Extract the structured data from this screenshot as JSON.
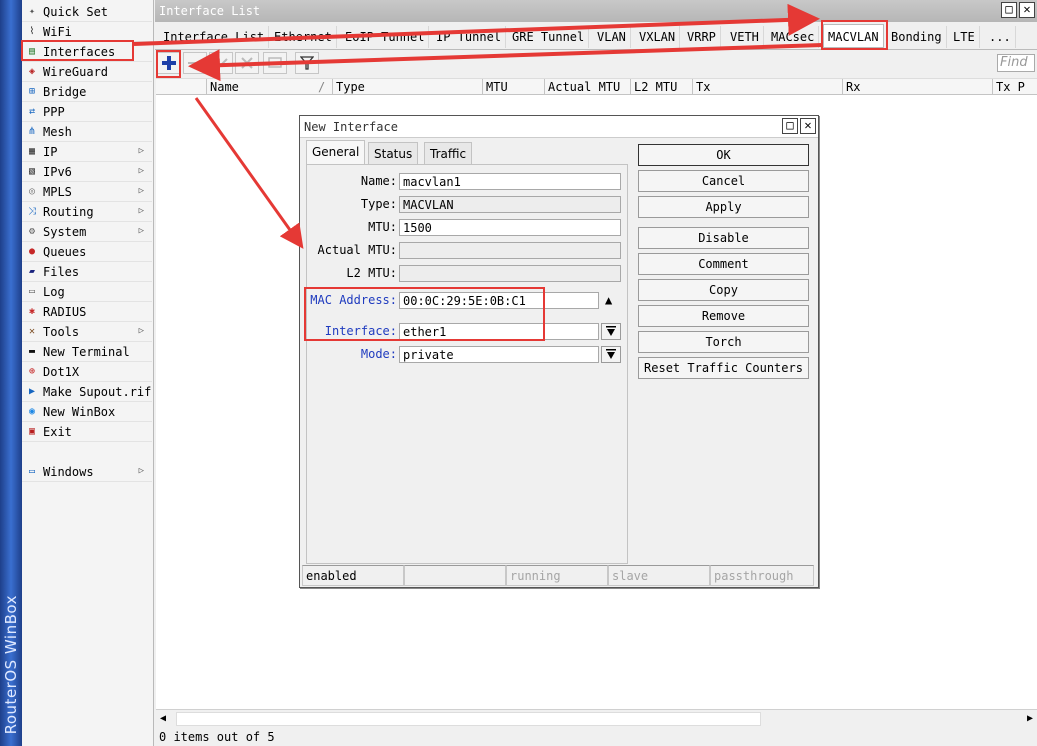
{
  "app": {
    "brand": "RouterOS WinBox",
    "window_title": "Interface List"
  },
  "sidebar": {
    "items": [
      {
        "label": "Quick Set",
        "icon": "wand-icon",
        "submenu": false
      },
      {
        "label": "WiFi",
        "icon": "antenna-icon",
        "submenu": false
      },
      {
        "label": "Interfaces",
        "icon": "interfaces-icon",
        "submenu": false
      },
      {
        "label": "WireGuard",
        "icon": "wireguard-icon",
        "submenu": false
      },
      {
        "label": "Bridge",
        "icon": "bridge-icon",
        "submenu": false
      },
      {
        "label": "PPP",
        "icon": "ppp-icon",
        "submenu": false
      },
      {
        "label": "Mesh",
        "icon": "mesh-icon",
        "submenu": false
      },
      {
        "label": "IP",
        "icon": "ip-icon",
        "submenu": true
      },
      {
        "label": "IPv6",
        "icon": "ipv6-icon",
        "submenu": true
      },
      {
        "label": "MPLS",
        "icon": "mpls-icon",
        "submenu": true
      },
      {
        "label": "Routing",
        "icon": "routing-icon",
        "submenu": true
      },
      {
        "label": "System",
        "icon": "gear-icon",
        "submenu": true
      },
      {
        "label": "Queues",
        "icon": "queues-icon",
        "submenu": false
      },
      {
        "label": "Files",
        "icon": "folder-icon",
        "submenu": false
      },
      {
        "label": "Log",
        "icon": "log-icon",
        "submenu": false
      },
      {
        "label": "RADIUS",
        "icon": "radius-icon",
        "submenu": false
      },
      {
        "label": "Tools",
        "icon": "tools-icon",
        "submenu": true
      },
      {
        "label": "New Terminal",
        "icon": "terminal-icon",
        "submenu": false
      },
      {
        "label": "Dot1X",
        "icon": "dot1x-icon",
        "submenu": false
      },
      {
        "label": "Make Supout.rif",
        "icon": "supout-icon",
        "submenu": false
      },
      {
        "label": "New WinBox",
        "icon": "winbox-icon",
        "submenu": false
      },
      {
        "label": "Exit",
        "icon": "exit-icon",
        "submenu": false
      }
    ],
    "windows_item": {
      "label": "Windows",
      "icon": "windows-icon",
      "submenu": true
    }
  },
  "tabs": [
    "Interface List",
    "Ethernet",
    "EoIP Tunnel",
    "IP Tunnel",
    "GRE Tunnel",
    "VLAN",
    "VXLAN",
    "VRRP",
    "VETH",
    "MACsec",
    "MACVLAN",
    "Bonding",
    "LTE",
    "..."
  ],
  "active_tab": "MACVLAN",
  "toolbar": {
    "find_placeholder": "Find"
  },
  "table": {
    "columns": [
      "Name",
      "Type",
      "MTU",
      "Actual MTU",
      "L2 MTU",
      "Tx",
      "Rx",
      "Tx P"
    ],
    "rows": []
  },
  "status": {
    "items_text": "0 items out of 5"
  },
  "dialog": {
    "title": "New Interface",
    "tabs": [
      "General",
      "Status",
      "Traffic"
    ],
    "active_tab": "General",
    "fields": {
      "name_label": "Name:",
      "name_value": "macvlan1",
      "type_label": "Type:",
      "type_value": "MACVLAN",
      "mtu_label": "MTU:",
      "mtu_value": "1500",
      "actual_mtu_label": "Actual MTU:",
      "actual_mtu_value": "",
      "l2_mtu_label": "L2 MTU:",
      "l2_mtu_value": "",
      "mac_label": "MAC Address:",
      "mac_value": "00:0C:29:5E:0B:C1",
      "interface_label": "Interface:",
      "interface_value": "ether1",
      "mode_label": "Mode:",
      "mode_value": "private"
    },
    "buttons": [
      "OK",
      "Cancel",
      "Apply",
      "Disable",
      "Comment",
      "Copy",
      "Remove",
      "Torch",
      "Reset Traffic Counters"
    ],
    "status_cells": [
      "enabled",
      "",
      "running",
      "slave",
      "passthrough"
    ]
  },
  "annotation_color": "#e53935"
}
